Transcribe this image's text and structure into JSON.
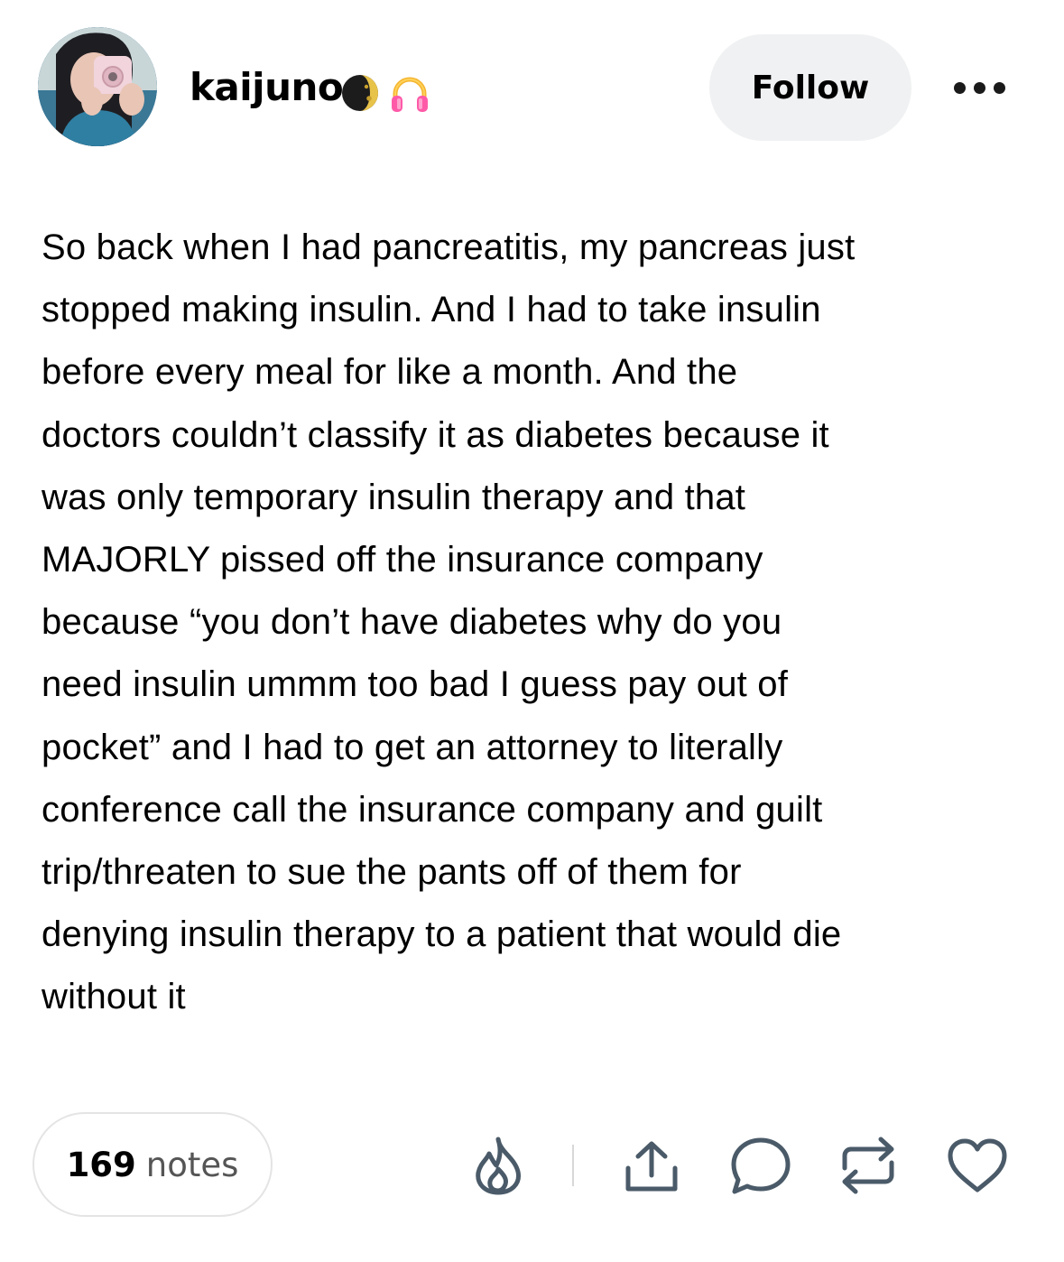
{
  "post": {
    "username": "kaijuno",
    "follow_label": "Follow",
    "body_lines": [
      "So back when I had pancreatitis, my pancreas just",
      "stopped making insulin. And I had to take insulin",
      "before every meal for like a month. And the",
      "doctors couldn’t classify it as diabetes because it",
      "was only temporary insulin therapy and that",
      "MAJORLY pissed off the insurance company",
      "because “you don’t have diabetes why do you",
      "need insulin ummm too bad I guess pay out of",
      "pocket” and I had to get an attorney to literally",
      "conference call the insurance company and guilt",
      "trip/threaten to sue the pants off of them for",
      "denying insulin therapy to a patient that would die",
      "without it"
    ],
    "notes_count": "169",
    "notes_label": "notes"
  },
  "icons": {
    "badges": [
      "moon-icon",
      "headphones-icon"
    ],
    "actions": [
      "flame-icon",
      "share-icon",
      "reply-icon",
      "reblog-icon",
      "like-icon"
    ],
    "menu": "more-icon"
  },
  "colors": {
    "follow_bg": "#f0f1f2",
    "icon_stroke": "#4a5a68",
    "headphones": "#ff5aa8"
  }
}
